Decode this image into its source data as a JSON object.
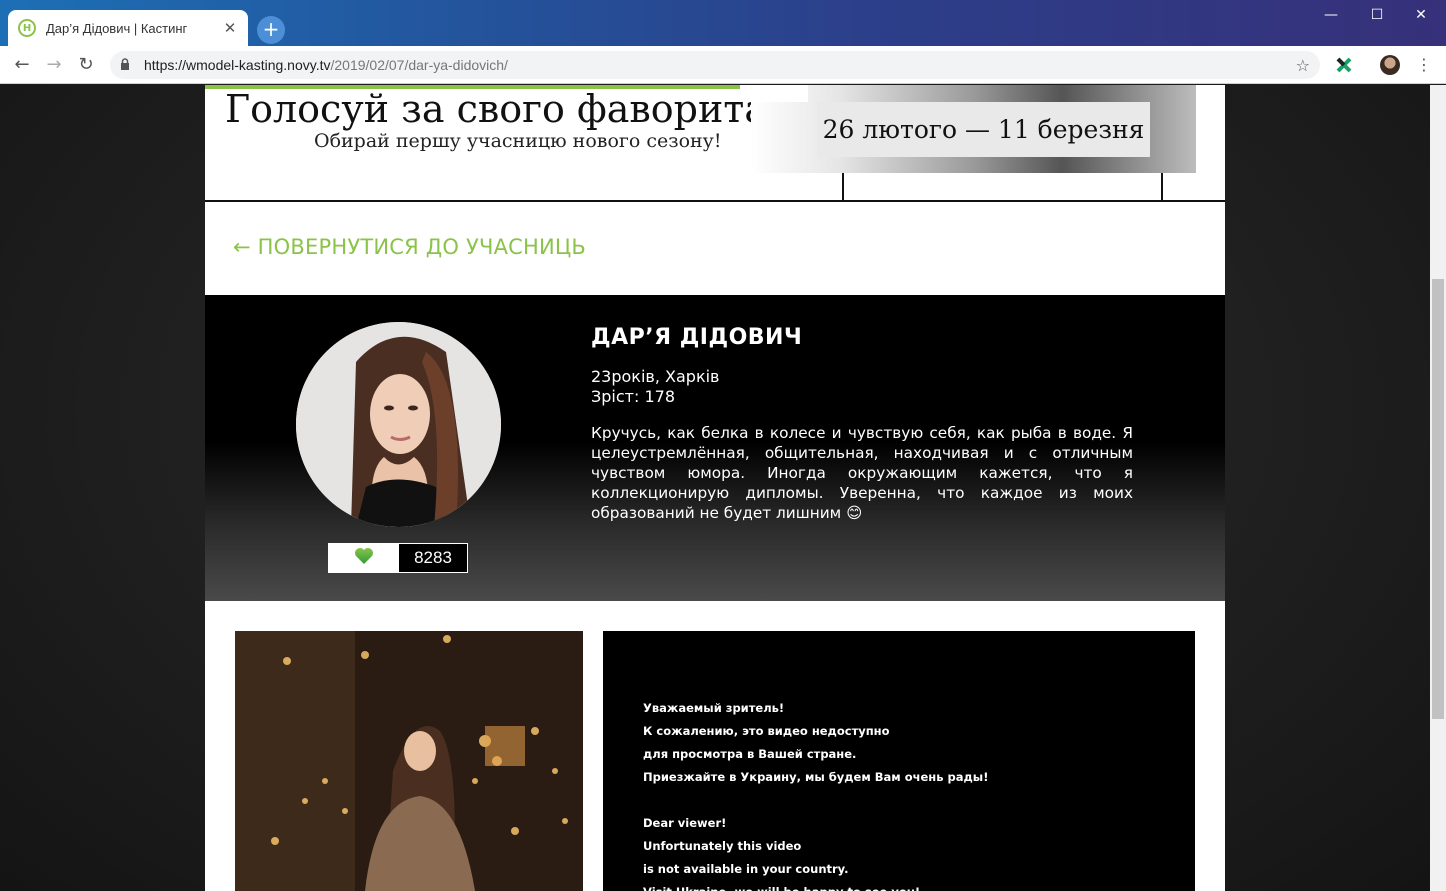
{
  "browser": {
    "tab_title": "Дар’я Дідович | Кастинг",
    "tab_favicon_letter": "Н",
    "url_host": "https://wmodel-kasting.novy.tv",
    "url_path": "/2019/02/07/dar-ya-didovich/",
    "new_tab_symbol": "+",
    "close_tab_symbol": "✕"
  },
  "banner": {
    "title": "Голосуй за свого фаворита!",
    "subtitle": "Обирай першу учасницю нового сезону!",
    "dates": "26 лютого — 11 березня"
  },
  "back_link": "← ПОВЕРНУТИСЯ ДО УЧАСНИЦЬ",
  "profile": {
    "name": "ДАР’Я ДІДОВИЧ",
    "age_city": "23років, Харків",
    "height": "Зріст: 178",
    "bio": "Кручусь, как белка в колесе и чувствую себя, как рыба в воде. Я целеустремлённая, общительная, находчивая и с отличным чувством юмора. Иногда окружающим кажется, что я коллекционирую дипломы. Уверенна, что каждое из моих образований не будет лишним 😊",
    "votes": "8283"
  },
  "video_notice": {
    "lines": [
      "Уважаемый зритель!",
      "К сожалению, это видео недоступно",
      "для просмотра в Вашей стране.",
      "Приезжайте в Украину, мы будем Вам очень рады!",
      "",
      "Dear viewer!",
      "Unfortunately this video",
      "is not available in your country.",
      "Visit Ukraine, we will be happy to see you!"
    ]
  },
  "colors": {
    "accent_green": "#8bc34a",
    "chrome_blue": "#1d6fb5",
    "chrome_purple": "#37307a",
    "profile_bg": "#000000"
  },
  "icons": {
    "back": "arrow-left-icon",
    "forward": "arrow-right-icon",
    "reload": "reload-icon",
    "lock": "lock-icon",
    "bookmark": "star-icon",
    "vote": "heart-icon",
    "menu": "kebab-menu-icon"
  }
}
